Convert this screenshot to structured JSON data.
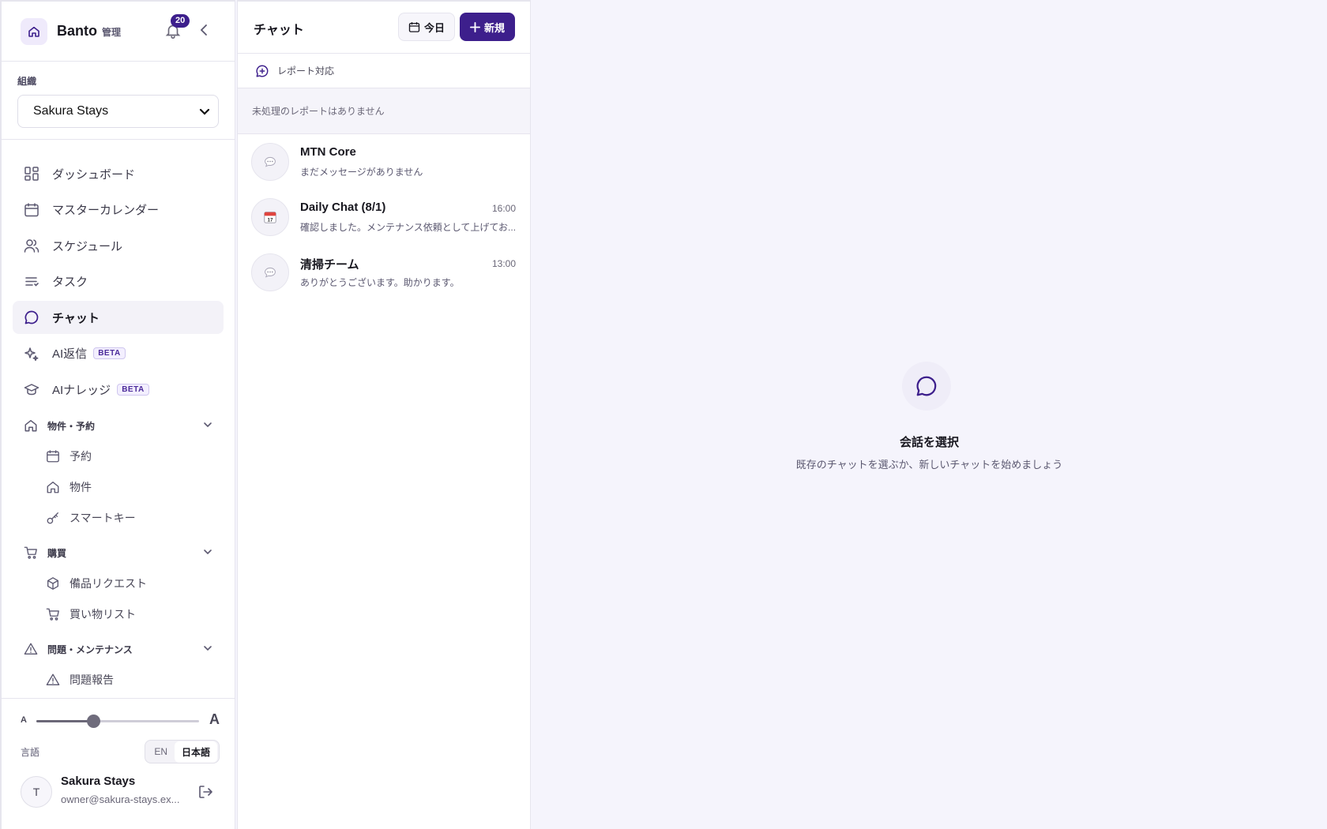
{
  "app": {
    "brand": "Banto",
    "brand_sub": "管理",
    "notification_count": "20"
  },
  "org": {
    "label": "組織",
    "selected": "Sakura Stays"
  },
  "nav": {
    "items": [
      {
        "label": "ダッシュボード"
      },
      {
        "label": "マスターカレンダー"
      },
      {
        "label": "スケジュール"
      },
      {
        "label": "タスク"
      },
      {
        "label": "チャット"
      },
      {
        "label": "AI返信",
        "badge": "BETA"
      },
      {
        "label": "AIナレッジ",
        "badge": "BETA"
      }
    ],
    "groups": [
      {
        "label": "物件・予約",
        "subs": [
          "予約",
          "物件",
          "スマートキー"
        ]
      },
      {
        "label": "購買",
        "subs": [
          "備品リクエスト",
          "買い物リスト"
        ]
      },
      {
        "label": "問題・メンテナンス",
        "subs": [
          "問題報告"
        ]
      }
    ]
  },
  "font_size": {
    "small_label": "A",
    "large_label": "A",
    "level": 0.35
  },
  "language": {
    "label": "言語",
    "options": [
      "EN",
      "日本語"
    ],
    "selected": "日本語"
  },
  "user": {
    "avatar": "T",
    "name": "Sakura Stays",
    "email": "owner@sakura-stays.ex..."
  },
  "chat": {
    "title": "チャット",
    "today_label": "今日",
    "new_label": "新規",
    "report_label": "レポート対応",
    "no_reports": "未処理のレポートはありません",
    "conversations": [
      {
        "name": "MTN Core",
        "time": "",
        "preview": "まだメッセージがありません",
        "icon": "speech-bubble-icon"
      },
      {
        "name": "Daily Chat (8/1)",
        "time": "16:00",
        "preview": "確認しました。メンテナンス依頼として上げてお...",
        "icon": "calendar-icon"
      },
      {
        "name": "清掃チーム",
        "time": "13:00",
        "preview": "ありがとうございます。助かります。",
        "icon": "speech-bubble-icon"
      }
    ]
  },
  "main": {
    "empty_title": "会話を選択",
    "empty_subtitle": "既存のチャットを選ぶか、新しいチャットを始めましょう"
  },
  "colors": {
    "accent": "#3d1f8c",
    "background": "#f5f4fc"
  }
}
